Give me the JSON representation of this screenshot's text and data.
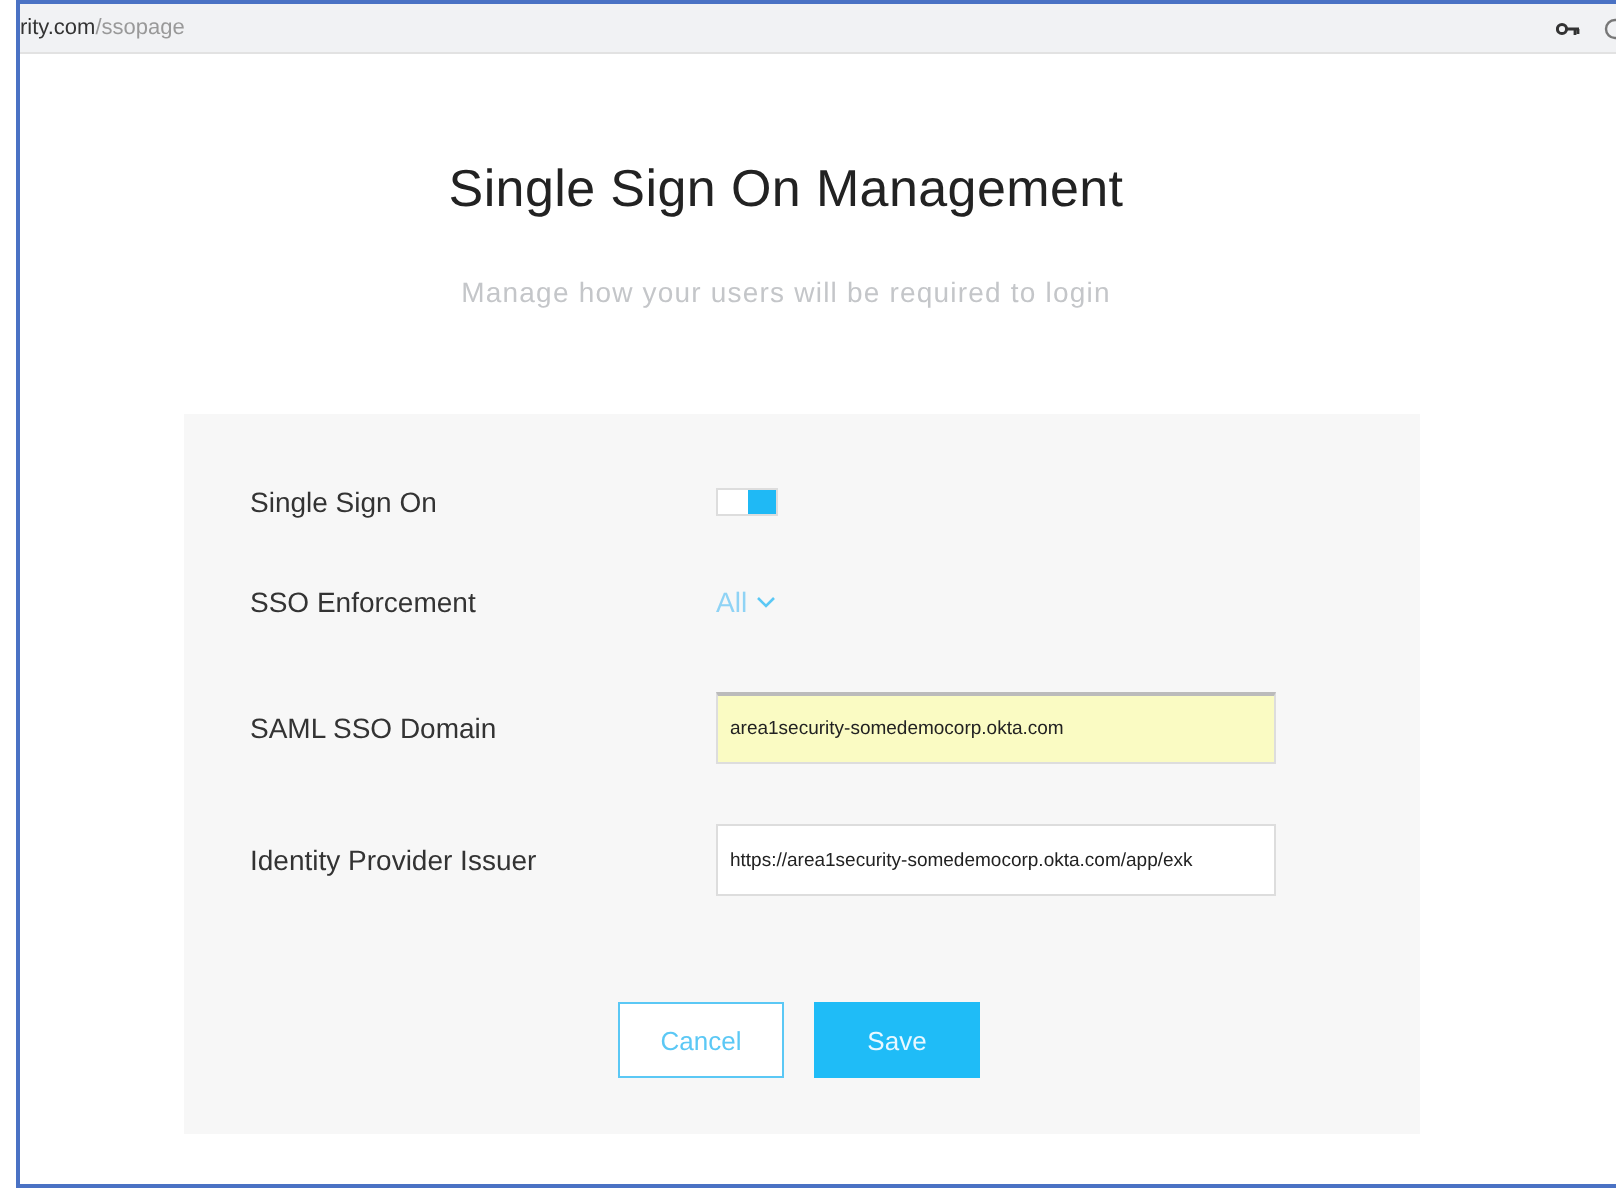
{
  "address_bar": {
    "host": "rity.com",
    "path": "/ssopage"
  },
  "page": {
    "title": "Single Sign On Management",
    "subtitle": "Manage how your users will be required to login"
  },
  "settings": [
    {
      "kind": "toggle",
      "label": "Single Sign On",
      "on": true
    },
    {
      "kind": "dropdown",
      "label": "SSO Enforcement",
      "value": "All"
    },
    {
      "kind": "text",
      "label": "SAML SSO Domain",
      "value": "area1security-somedemocorp.okta.com",
      "autofilled": true
    },
    {
      "kind": "text",
      "label": "Identity Provider Issuer",
      "value": "https://area1security-somedemocorp.okta.com/app/exk",
      "autofilled": false
    }
  ],
  "buttons": [
    {
      "kind": "secondary",
      "label": "Cancel"
    },
    {
      "kind": "primary",
      "label": "Save"
    }
  ]
}
